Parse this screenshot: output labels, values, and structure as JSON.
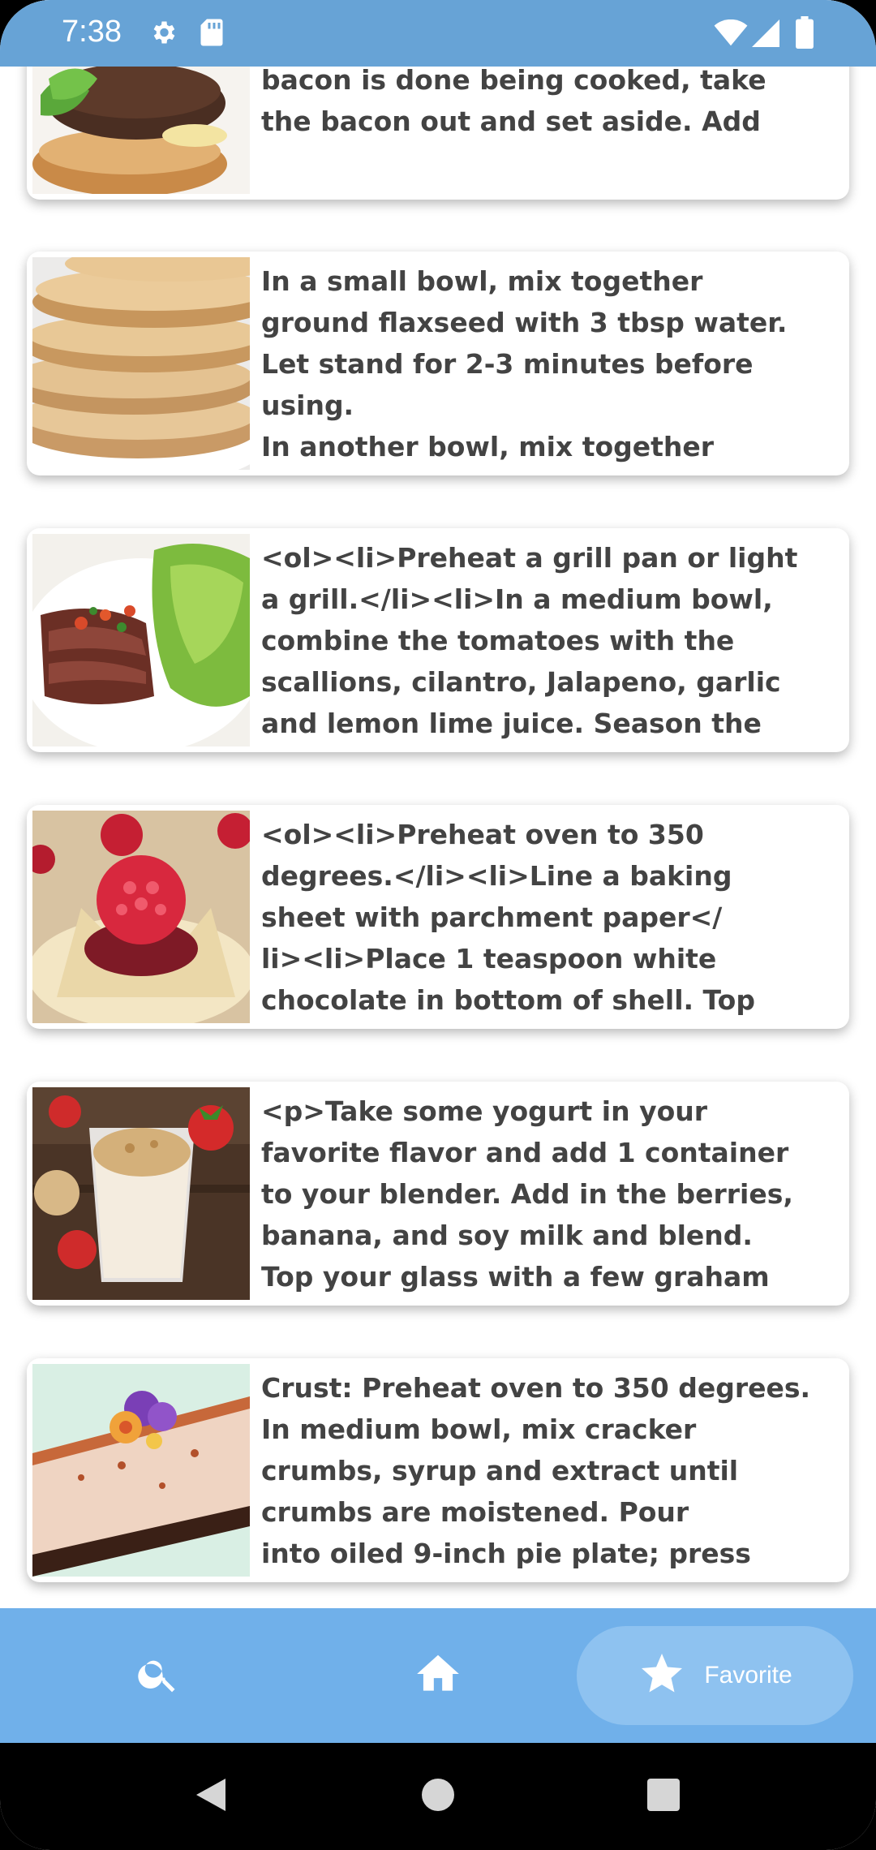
{
  "status_bar": {
    "time": "7:38",
    "icons": [
      "settings-icon",
      "sd-card-icon",
      "wifi-icon",
      "cell-signal-icon",
      "battery-icon"
    ],
    "background": "#67a3d6"
  },
  "recipes": [
    {
      "image": "burger",
      "text": "directions on package.</li><li>Once\nbacon is done being cooked, take\nthe bacon out and set aside. Add"
    },
    {
      "image": "pancakes",
      "text": "In a small bowl, mix together\nground flaxseed with 3 tbsp water.\nLet stand for 2-3 minutes before\nusing.\nIn another bowl, mix together"
    },
    {
      "image": "steak-salad",
      "text": "<ol><li>Preheat a grill pan or light\na grill.</li><li>In a medium bowl,\ncombine the tomatoes with the\nscallions, cilantro, Jalapeno, garlic\nand lemon  lime juice. Season the"
    },
    {
      "image": "raspberry-tarts",
      "text": "<ol><li>Preheat oven to 350\ndegrees.</li><li>Line a baking\nsheet with parchment paper</\nli><li>Place 1 teaspoon white\nchocolate in bottom of shell. Top"
    },
    {
      "image": "smoothie",
      "text": "<p>Take some yogurt in your\nfavorite flavor and add 1 container\nto your blender. Add in the berries,\nbanana, and soy milk and blend.\nTop your glass with a few graham"
    },
    {
      "image": "cheesecake",
      "text": "Crust: Preheat oven to 350 degrees.\nIn medium bowl, mix cracker\ncrumbs, syrup and extract until\ncrumbs are moistened. Pour\ninto oiled 9-inch pie plate; press"
    }
  ],
  "bottom_nav": {
    "items": [
      {
        "icon": "search-icon",
        "label": ""
      },
      {
        "icon": "home-icon",
        "label": ""
      },
      {
        "icon": "star-icon",
        "label": "Favorite",
        "selected": true
      }
    ],
    "background": "#70b0ea",
    "selected_pill": "#8ec2f0"
  },
  "system_nav": {
    "buttons": [
      "back-icon",
      "home-circle-icon",
      "recents-icon"
    ]
  }
}
